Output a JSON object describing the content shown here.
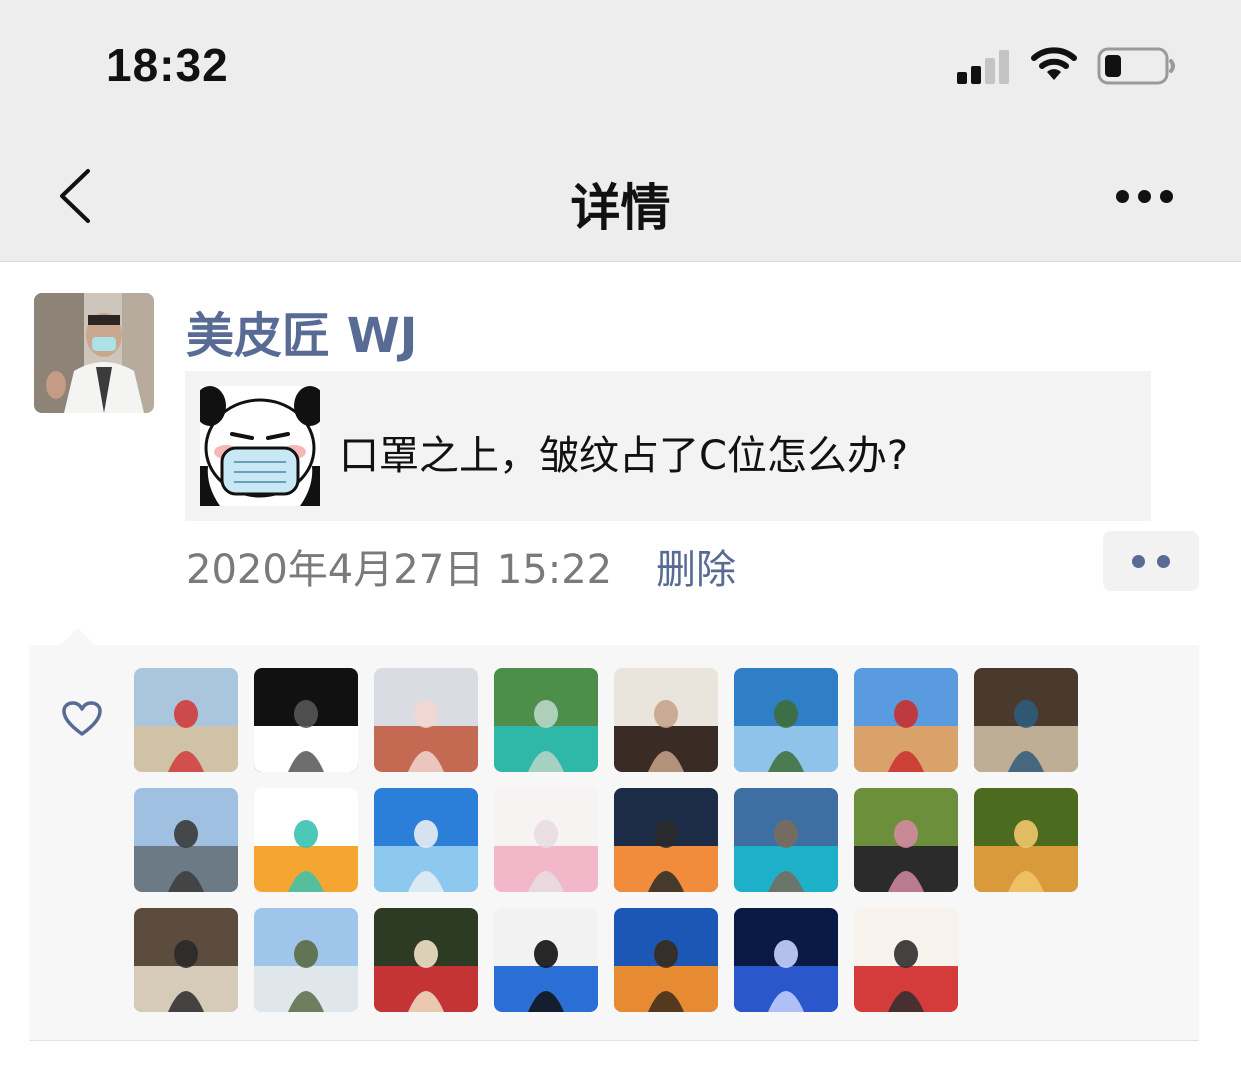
{
  "status_bar": {
    "time": "18:32"
  },
  "nav": {
    "title": "详情"
  },
  "post": {
    "author": "美皮匠 WJ",
    "share_title": "口罩之上，皱纹占了C位怎么办?",
    "timestamp": "2020年4月27日 15:22",
    "delete_label": "删除"
  },
  "likes": {
    "avatars": [
      "beach-man-red-shirt",
      "black-white-hands-face",
      "waterfront-woman",
      "lake-mountains",
      "woman-glasses-smiling",
      "coast-palms",
      "woman-red-dress-desert",
      "shelf-interior",
      "woman-seaside-rocks",
      "health-app-logo",
      "infinity-pool-city",
      "mother-child-pink",
      "sunset-horizon",
      "mountain-lake-person",
      "couple-greenery",
      "chipmunk",
      "woman-old-building",
      "city-skyline",
      "two-women-uniform",
      "blue-sphere-person",
      "desert-dead-tree",
      "night-city-lights",
      "woman-at-table"
    ]
  }
}
